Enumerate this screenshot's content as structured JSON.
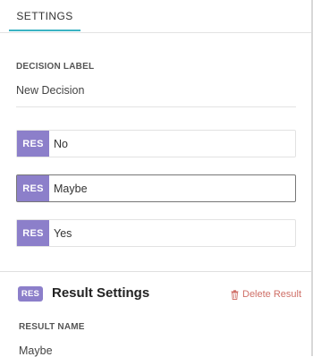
{
  "tabs": [
    {
      "label": "SETTINGS"
    }
  ],
  "decision": {
    "section_label": "DECISION LABEL",
    "value": "New Decision"
  },
  "results": [
    {
      "badge": "RES",
      "value": "No"
    },
    {
      "badge": "RES",
      "value": "Maybe"
    },
    {
      "badge": "RES",
      "value": "Yes"
    }
  ],
  "result_settings": {
    "badge": "RES",
    "title": "Result Settings",
    "delete_label": "Delete Result",
    "name_label": "RESULT NAME",
    "name_value": "Maybe"
  },
  "colors": {
    "accent": "#3bb3c3",
    "badge": "#8c7fca",
    "delete": "#cf6f67"
  },
  "icons": [
    "trash-icon"
  ]
}
